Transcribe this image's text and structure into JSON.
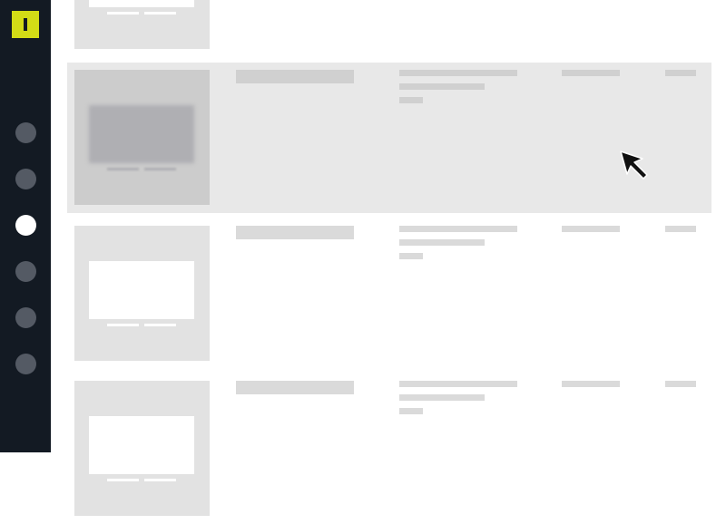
{
  "app": {
    "logo_icon": "brand-logo-icon",
    "accent_color": "#d3dc16",
    "sidebar_color": "#131a23"
  },
  "sidebar": {
    "items": [
      {
        "icon": "nav-dot-icon",
        "active": false
      },
      {
        "icon": "nav-dot-icon",
        "active": false
      },
      {
        "icon": "nav-dot-icon",
        "active": true
      },
      {
        "icon": "nav-dot-icon",
        "active": false
      },
      {
        "icon": "nav-dot-icon",
        "active": false
      },
      {
        "icon": "nav-dot-icon",
        "active": false
      }
    ]
  },
  "list": {
    "rows": [
      {
        "thumbnail_icon": "monitor-placeholder-icon",
        "state": "partially-visible"
      },
      {
        "thumbnail_icon": "monitor-placeholder-icon",
        "state": "hovered"
      },
      {
        "thumbnail_icon": "monitor-placeholder-icon",
        "state": "normal"
      },
      {
        "thumbnail_icon": "monitor-placeholder-icon",
        "state": "partially-visible"
      }
    ],
    "hover_color": "#e8e8e8",
    "placeholder_color": "#dadada"
  },
  "cursor": {
    "icon": "mouse-pointer-icon"
  }
}
